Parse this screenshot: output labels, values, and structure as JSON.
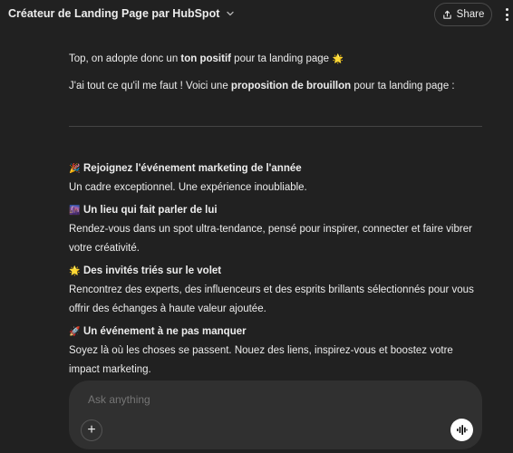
{
  "header": {
    "title": "Créateur de Landing Page par HubSpot",
    "share_label": "Share"
  },
  "message": {
    "intro_prefix": "Top, on adopte donc un ",
    "intro_bold": "ton positif",
    "intro_suffix": " pour ta landing page ",
    "intro_emoji": "🌟",
    "line2_prefix": "J'ai tout ce qu'il me faut ! Voici une ",
    "line2_bold": "proposition de brouillon",
    "line2_suffix": " pour ta landing page :",
    "sections": [
      {
        "emoji": "🎉",
        "heading": "Rejoignez l'événement marketing de l'année",
        "body": "Un cadre exceptionnel. Une expérience inoubliable."
      },
      {
        "emoji": "🌆",
        "heading": "Un lieu qui fait parler de lui",
        "body": "Rendez-vous dans un spot ultra-tendance, pensé pour inspirer, connecter et faire vibrer votre créativité."
      },
      {
        "emoji": "🌟",
        "heading": "Des invités triés sur le volet",
        "body": "Rencontrez des experts, des influenceurs et des esprits brillants sélectionnés pour vous offrir des échanges à haute valeur ajoutée."
      },
      {
        "emoji": "🚀",
        "heading": "Un événement à ne pas manquer",
        "body": "Soyez là où les choses se passent. Nouez des liens, inspirez-vous et boostez votre impact marketing."
      }
    ]
  },
  "composer": {
    "placeholder": "Ask anything",
    "plus_label": "+"
  },
  "icons": {
    "title_chevron": "chevron-down-icon",
    "share": "share-icon",
    "more": "more-vertical-icon",
    "plus": "plus-icon",
    "voice": "voice-waveform-icon"
  },
  "colors": {
    "background": "#212121",
    "composer_bg": "#303030",
    "text": "#ececec",
    "placeholder": "#9b9b9b"
  }
}
